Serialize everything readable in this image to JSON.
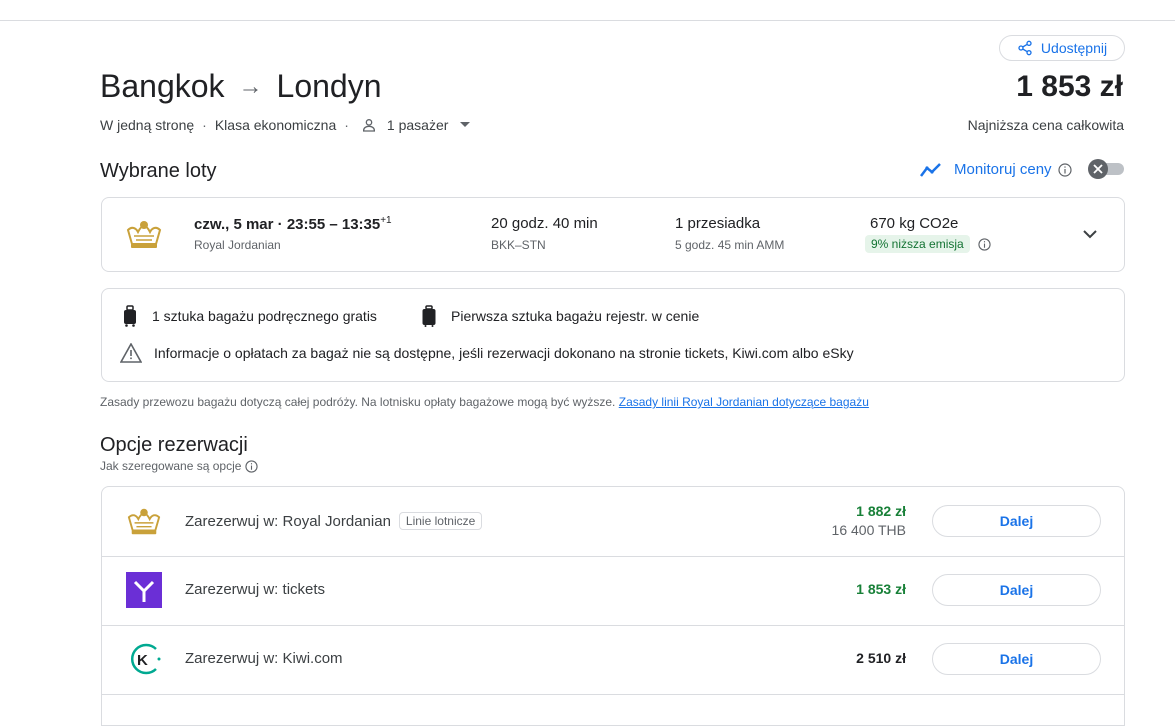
{
  "share": {
    "label": "Udostępnij"
  },
  "route": {
    "from": "Bangkok",
    "to": "Londyn",
    "arrow": "→"
  },
  "price": {
    "total": "1 853 zł",
    "caption": "Najniższa cena całkowita"
  },
  "trip": {
    "type": "W jedną stronę",
    "class": "Klasa ekonomiczna",
    "passengers": "1 pasażer"
  },
  "selected": {
    "title": "Wybrane loty",
    "monitor_label": "Monitoruj ceny",
    "flight": {
      "date_time": "czw., 5 mar · 23:55 – 13:35",
      "day_offset": "+1",
      "airline": "Royal Jordanian",
      "duration": "20 godz. 40 min",
      "airports": "BKK–STN",
      "stops": "1 przesiadka",
      "layover": "5 godz. 45 min AMM",
      "co2": "670 kg CO2e",
      "emission_badge": "9% niższa emisja"
    }
  },
  "baggage": {
    "carry_on": "1 sztuka bagażu podręcznego gratis",
    "checked": "Pierwsza sztuka bagażu rejestr. w cenie",
    "warning": "Informacje o opłatach za bagaż nie są dostępne, jeśli rezerwacji dokonano na stronie tickets, Kiwi.com albo eSky",
    "rules_text": "Zasady przewozu bagażu dotyczą całej podróży. Na lotnisku opłaty bagażowe mogą być wyższe.",
    "rules_link": "Zasady linii Royal Jordanian dotyczące bagażu"
  },
  "booking": {
    "title": "Opcje rezerwacji",
    "ranking_label": "Jak szeregowane są opcje",
    "options": [
      {
        "name": "Zarezerwuj w: Royal Jordanian",
        "tag": "Linie lotnicze",
        "price": "1 882 zł",
        "price_alt": "16 400 THB",
        "button": "Dalej"
      },
      {
        "name": "Zarezerwuj w: tickets",
        "price": "1 853 zł",
        "button": "Dalej"
      },
      {
        "name": "Zarezerwuj w: Kiwi.com",
        "price": "2 510 zł",
        "button": "Dalej"
      }
    ]
  },
  "colors": {
    "accent": "#1a73e8",
    "green_price": "#188038",
    "emission_bg": "#e6f4ea",
    "tickets_brand": "#6b2fd6",
    "kiwi_brand": "#00a991",
    "crown_gold": "#c9a13a"
  }
}
